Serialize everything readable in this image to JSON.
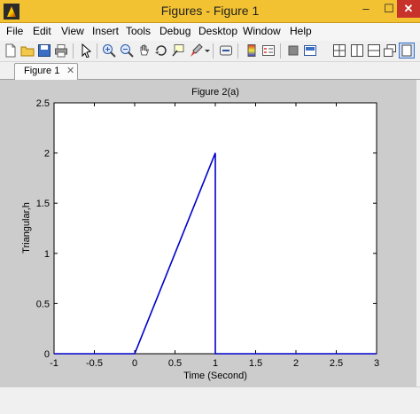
{
  "window": {
    "title": "Figures - Figure 1",
    "min": "–",
    "max": "☐",
    "close": "✕"
  },
  "menu": [
    "File",
    "Edit",
    "View",
    "Insert",
    "Tools",
    "Debug",
    "Desktop",
    "Window",
    "Help"
  ],
  "tabs": [
    {
      "label": "Figure 1",
      "close": "✕"
    }
  ],
  "colors": {
    "titlebar": "#f3c232",
    "line": "#0000cc",
    "figure_bg": "#cccccc"
  },
  "chart_data": {
    "type": "line",
    "title": "Figure 2(a)",
    "xlabel": "Time (Second)",
    "ylabel": "Triangular,h",
    "xlim": [
      -1,
      3
    ],
    "ylim": [
      0,
      2.5
    ],
    "xticks": [
      -1,
      -0.5,
      0,
      0.5,
      1,
      1.5,
      2,
      2.5,
      3
    ],
    "yticks": [
      0,
      0.5,
      1,
      1.5,
      2,
      2.5
    ],
    "grid": false,
    "series": [
      {
        "x": [
          -1,
          0,
          1,
          1,
          3
        ],
        "y": [
          0,
          0,
          2,
          0,
          0
        ]
      }
    ]
  }
}
